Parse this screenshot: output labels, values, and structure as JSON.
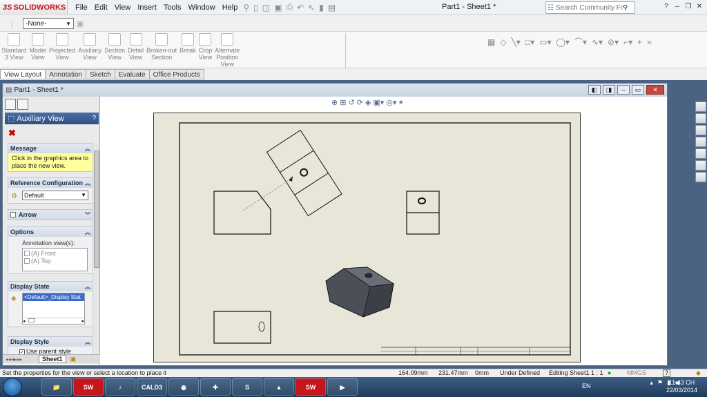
{
  "app": {
    "brand_ds": "3S",
    "brand_name": "SOLIDWORKS",
    "menu": [
      "File",
      "Edit",
      "View",
      "Insert",
      "Tools",
      "Window",
      "Help"
    ],
    "document_title": "Part1 - Sheet1 *",
    "search_placeholder": "Search Community Forum",
    "help_label": "?"
  },
  "config_bar": {
    "config_value": "-None-"
  },
  "ribbon": {
    "buttons": [
      {
        "label": "Standard 3 View",
        "l1": "Standard",
        "l2": "3 View"
      },
      {
        "label": "Model View",
        "l1": "Model",
        "l2": "View"
      },
      {
        "label": "Projected View",
        "l1": "Projected",
        "l2": "View"
      },
      {
        "label": "Auxiliary View",
        "l1": "Auxiliary",
        "l2": "View"
      },
      {
        "label": "Section View",
        "l1": "Section",
        "l2": "View"
      },
      {
        "label": "Detail View",
        "l1": "Detail",
        "l2": "View"
      },
      {
        "label": "Broken-out Section",
        "l1": "Broken-out",
        "l2": "Section"
      },
      {
        "label": "Break",
        "l1": "Break",
        "l2": ""
      },
      {
        "label": "Crop View",
        "l1": "Crop",
        "l2": "View"
      },
      {
        "label": "Alternate Position View",
        "l1": "Alternate",
        "l2": "Position",
        "l3": "View"
      }
    ]
  },
  "tabs": [
    "View Layout",
    "Annotation",
    "Sketch",
    "Evaluate",
    "Office Products"
  ],
  "doc_window": {
    "title": "Part1 - Sheet1 *"
  },
  "property_manager": {
    "title": "Auxiliary View",
    "help": "?",
    "message_header": "Message",
    "message_text": "Click in the graphics area to place the new view.",
    "ref_config_header": "Reference Configuration",
    "ref_config_value": "Default",
    "arrow_header": "Arrow",
    "options_header": "Options",
    "annotation_views_label": "Annotation view(s):",
    "annotation_views": [
      "(A) Front",
      "(A) Top"
    ],
    "display_state_header": "Display State",
    "display_state_value": "<Default>_Display Stat",
    "display_style_header": "Display Style",
    "use_parent_style": "Use parent style"
  },
  "sheet_tab": "Sheet1",
  "status_bar": {
    "prompt": "Set the properties for the view or select a location to place it",
    "x": "164.09mm",
    "y": "231.47mm",
    "z": "0mm",
    "state": "Under Defined",
    "editing": "Editing Sheet1",
    "scale": "1 : 1",
    "units": "MMGS",
    "help": "?"
  },
  "taskbar": {
    "apps": [
      "SW",
      "CALD3",
      "SW",
      "SW"
    ],
    "lang": "EN",
    "time": "11:43 CH",
    "date": "22/03/2014"
  }
}
